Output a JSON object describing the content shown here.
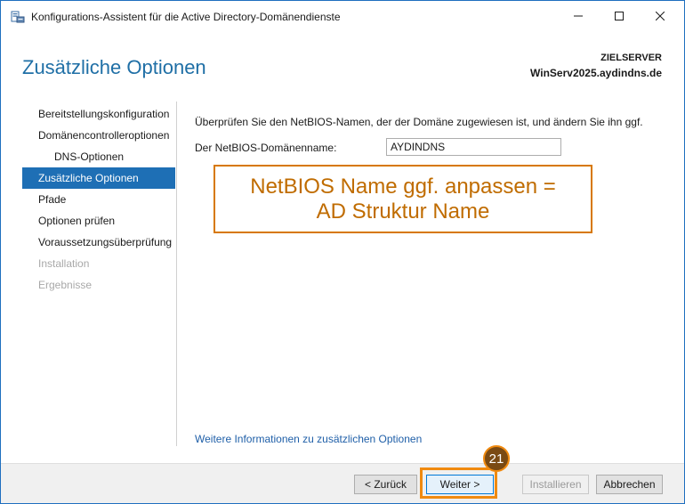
{
  "window": {
    "title": "Konfigurations-Assistent für die Active Directory-Domänendienste",
    "minimize_glyph": "—",
    "maximize_glyph": "☐",
    "close_glyph": "✕",
    "app_icon": "server-manager-icon"
  },
  "header": {
    "page_title": "Zusätzliche Optionen",
    "target_server_label": "ZIELSERVER",
    "target_server_name": "WinServ2025.aydindns.de"
  },
  "nav": {
    "items": [
      {
        "label": "Bereitstellungskonfiguration",
        "state": "normal"
      },
      {
        "label": "Domänencontrolleroptionen",
        "state": "normal"
      },
      {
        "label": "DNS-Optionen",
        "state": "normal"
      },
      {
        "label": "Zusätzliche Optionen",
        "state": "active"
      },
      {
        "label": "Pfade",
        "state": "normal"
      },
      {
        "label": "Optionen prüfen",
        "state": "normal"
      },
      {
        "label": "Voraussetzungsüberprüfung",
        "state": "normal"
      },
      {
        "label": "Installation",
        "state": "disabled"
      },
      {
        "label": "Ergebnisse",
        "state": "disabled"
      }
    ]
  },
  "main": {
    "instruction": "Überprüfen Sie den NetBIOS-Namen, der der Domäne zugewiesen ist, und ändern Sie ihn ggf.",
    "netbios_label": "Der NetBIOS-Domänenname:",
    "netbios_value": "AYDINDNS",
    "more_info_link": "Weitere Informationen zu zusätzlichen Optionen"
  },
  "annotation": {
    "line1": "NetBIOS Name ggf. anpassen =",
    "line2": "AD Struktur Name",
    "color": "#d77800",
    "step_number": "21"
  },
  "footer": {
    "back_label": "< Zurück",
    "next_label": "Weiter >",
    "install_label": "Installieren",
    "cancel_label": "Abbrechen"
  },
  "colors": {
    "accent": "#1e6fb5",
    "highlight": "#f08a10"
  }
}
